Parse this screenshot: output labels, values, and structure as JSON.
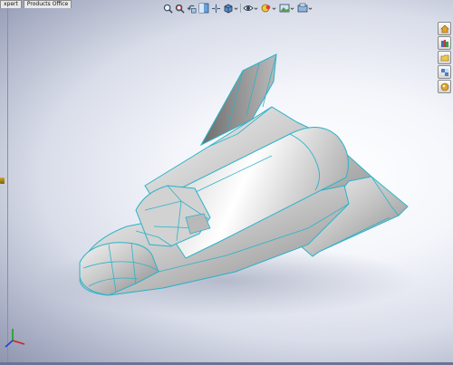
{
  "window": {
    "tabs": [
      "xpert",
      "Products Office"
    ]
  },
  "view_toolbar": {
    "icons": [
      "zoom-to-fit-icon",
      "zoom-to-area-icon",
      "previous-view-icon",
      "section-view-icon",
      "view-orientation-icon",
      "display-style-icon",
      "hide-show-items-icon",
      "edit-appearance-icon",
      "apply-scene-icon",
      "view-settings-icon"
    ]
  },
  "task_pane": {
    "icons": [
      "resources-home-icon",
      "design-library-icon",
      "file-explorer-icon",
      "view-palette-icon",
      "appearances-scenes-icon"
    ]
  },
  "graphics_area": {
    "model": "spaceplane-surface-model",
    "colors": {
      "body": "#c7c7c7",
      "edges": "#2ab3c8",
      "background_center": "#ffffff",
      "background_edge": "#8d94ad"
    }
  },
  "triad": {
    "axes": [
      "x-axis",
      "y-axis",
      "z-axis"
    ]
  }
}
